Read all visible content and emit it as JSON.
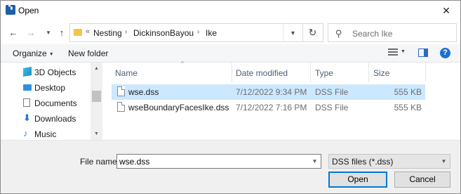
{
  "window": {
    "title": "Open",
    "app_icon": "hec-ras-app-icon"
  },
  "nav": {
    "back_icon": "arrow-left-icon",
    "forward_icon": "arrow-right-icon",
    "up_icon": "arrow-up-icon",
    "breadcrumb_prefix": "«",
    "breadcrumbs": [
      "Nesting",
      "DickinsonBayou",
      "Ike"
    ],
    "search_placeholder": "Search Ike"
  },
  "toolbar": {
    "organize_label": "Organize",
    "new_folder_label": "New folder"
  },
  "sidebar": {
    "items": [
      {
        "label": "3D Objects",
        "icon": "3d-objects-icon"
      },
      {
        "label": "Desktop",
        "icon": "desktop-icon"
      },
      {
        "label": "Documents",
        "icon": "documents-icon"
      },
      {
        "label": "Downloads",
        "icon": "downloads-icon"
      },
      {
        "label": "Music",
        "icon": "music-icon"
      }
    ]
  },
  "filelist": {
    "columns": {
      "name": "Name",
      "date": "Date modified",
      "type": "Type",
      "size": "Size"
    },
    "rows": [
      {
        "name": "wse.dss",
        "date": "7/12/2022 9:34 PM",
        "type": "DSS File",
        "size": "555 KB",
        "selected": true
      },
      {
        "name": "wseBoundaryFacesIke.dss",
        "date": "7/12/2022 7:16 PM",
        "type": "DSS File",
        "size": "555 KB",
        "selected": false
      }
    ]
  },
  "footer": {
    "file_name_label": "File name:",
    "file_name_value": "wse.dss",
    "filter_value": "DSS files (*.dss)",
    "open_label": "Open",
    "cancel_label": "Cancel"
  },
  "colors": {
    "accent": "#0078d7",
    "selection": "#cce8ff",
    "header_text": "#4c607a"
  }
}
